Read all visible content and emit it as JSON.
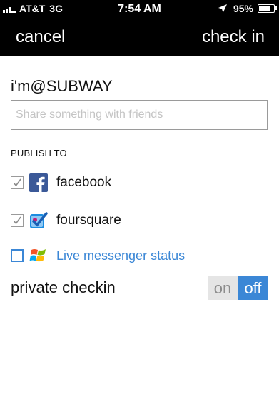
{
  "status_bar": {
    "carrier": "AT&T",
    "network": "3G",
    "time": "7:54 AM",
    "battery_text": "95%",
    "battery_level": 0.95,
    "signal_icon": "signal-bars-icon",
    "location_icon": "location-arrow-icon",
    "battery_icon": "battery-icon"
  },
  "nav": {
    "cancel_label": "cancel",
    "checkin_label": "check in"
  },
  "venue": {
    "label": "i'm@SUBWAY"
  },
  "share": {
    "value": "",
    "placeholder": "Share something with friends"
  },
  "publish": {
    "heading": "PUBLISH TO",
    "services": [
      {
        "label": "facebook",
        "checked": true,
        "icon": "facebook-icon"
      },
      {
        "label": "foursquare",
        "checked": true,
        "icon": "foursquare-icon"
      },
      {
        "label": "Live messenger status",
        "checked": false,
        "icon": "windows-icon"
      }
    ]
  },
  "private_checkin": {
    "label": "private checkin",
    "on_label": "on",
    "off_label": "off",
    "state": "off"
  },
  "colors": {
    "accent": "#3b87d6",
    "facebook": "#3b5998",
    "bar_background": "#000000"
  }
}
